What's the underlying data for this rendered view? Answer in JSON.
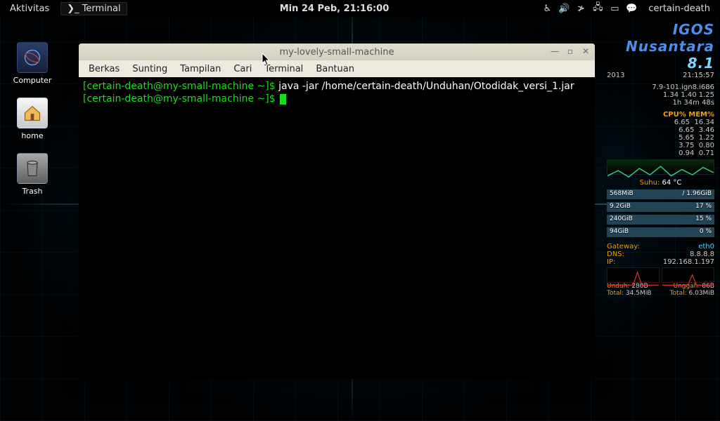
{
  "top_panel": {
    "activities": "Aktivitas",
    "task_label": "Terminal",
    "clock": "Min 24 Peb, 21:16:00",
    "user": "certain-death",
    "tray_icons": [
      "accessibility-icon",
      "volume-icon",
      "bluetooth-icon",
      "network-icon",
      "battery-icon",
      "chat-icon"
    ]
  },
  "desktop_icons": [
    {
      "name": "computer",
      "label": "Computer"
    },
    {
      "name": "home",
      "label": "home"
    },
    {
      "name": "trash",
      "label": "Trash"
    }
  ],
  "terminal_window": {
    "title": "my-lovely-small-machine",
    "menu": [
      "Berkas",
      "Sunting",
      "Tampilan",
      "Cari",
      "Terminal",
      "Bantuan"
    ],
    "prompt1": "[certain-death@my-small-machine ~]$ ",
    "cmd1": "java -jar /home/certain-death/Unduhan/Otodidak_versi_1.jar",
    "prompt2": "[certain-death@my-small-machine ~]$ "
  },
  "conky": {
    "distro_name": "IGOS Nusantara",
    "distro_ver": "8.1",
    "date_short": "2013",
    "time": "21:15:57",
    "kernel": "7.9-101.ign8.i686",
    "load": "1.34 1.40 1.25",
    "uptime": "1h 34m 48s",
    "cpu_header": "CPU% MEM%",
    "proc_rows": [
      {
        "c": "6.65",
        "m": "16.34"
      },
      {
        "c": "6.65",
        "m": "3.46"
      },
      {
        "c": "5.65",
        "m": "1.22"
      },
      {
        "c": "3.75",
        "m": "0.80"
      },
      {
        "c": "0.94",
        "m": "0.71"
      }
    ],
    "temp_label": "Suhu:",
    "temp_value": "64 °C",
    "bars": [
      {
        "left": "568MiB",
        "right": "/ 1.96GiB"
      },
      {
        "left": "9.2GiB",
        "right": "17 %"
      },
      {
        "left": "240GiB",
        "right": "15 %"
      },
      {
        "left": "94GiB",
        "right": "0 %"
      }
    ],
    "gw_label": "Gateway:",
    "gw_value": "eth0",
    "dns_label": "DNS:",
    "dns_value": "8.8.8.8",
    "ip_label": "IP:",
    "ip_value": "192.168.1.197",
    "dl_label": "Unduh:",
    "dl_value": "280B",
    "dl_total_label": "Total:",
    "dl_total": "34.5MiB",
    "ul_label": "Unggah:",
    "ul_value": "86B",
    "ul_total_label": "Total:",
    "ul_total": "6.03MiB"
  }
}
